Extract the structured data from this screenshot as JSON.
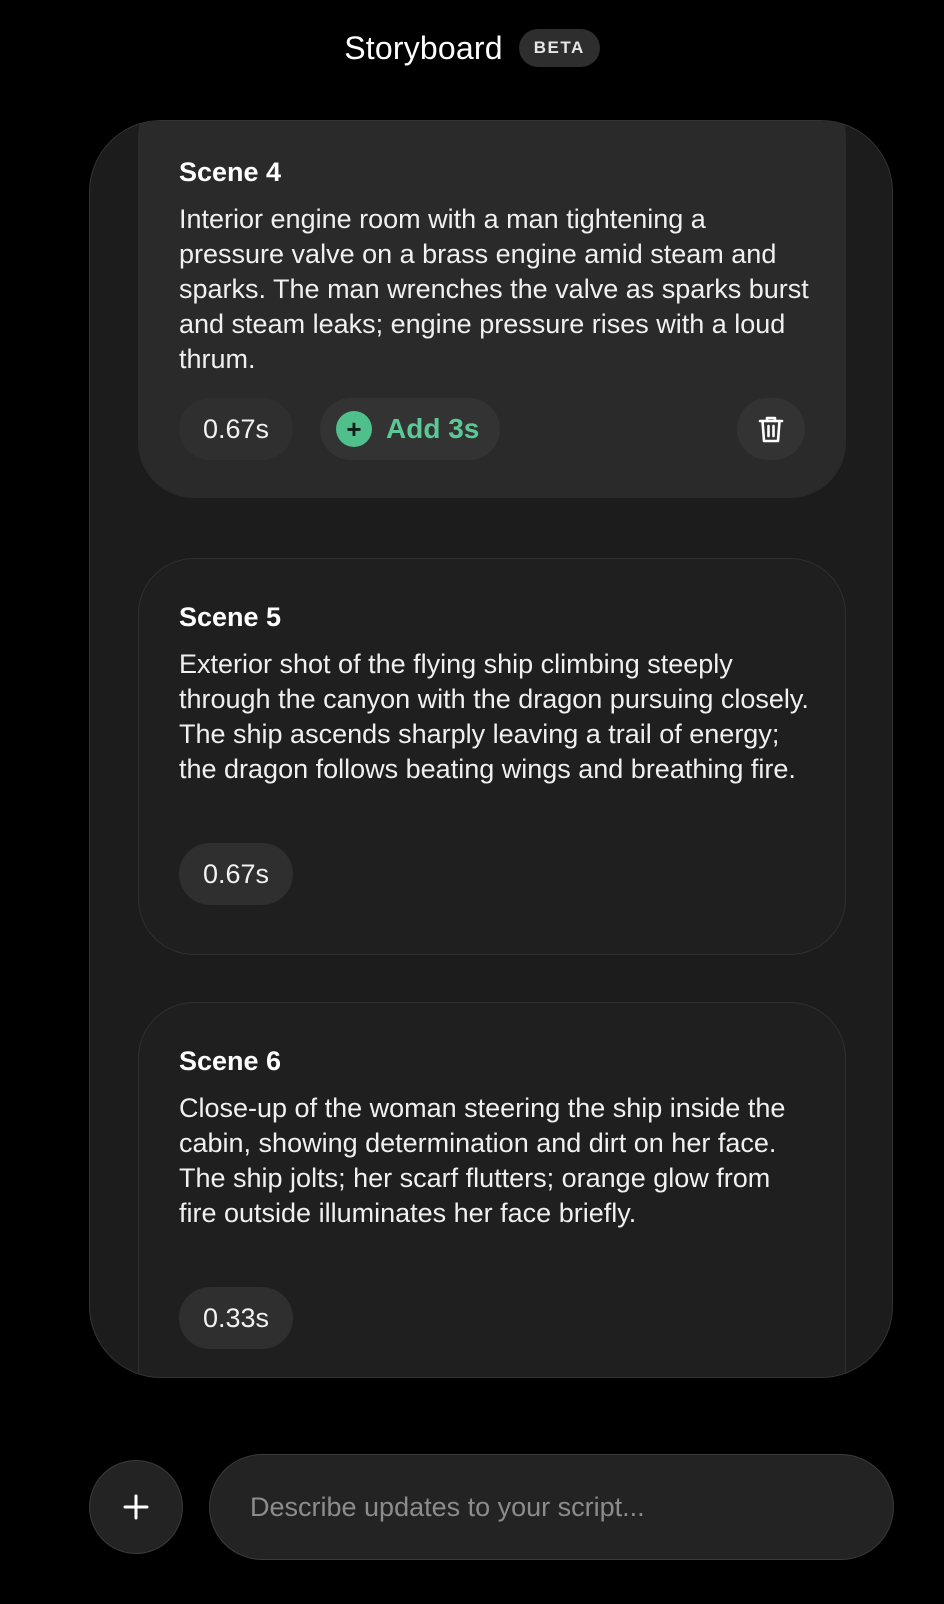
{
  "header": {
    "title": "Storyboard",
    "badge": "BETA"
  },
  "scenes": [
    {
      "heading": "Scene 4",
      "description": "Interior engine room with a man tightening a pressure valve on a brass engine amid steam and sparks. The man wrenches the valve as sparks burst and steam leaks; engine pressure rises with a loud thrum.",
      "duration": "0.67s",
      "add_label": "Add 3s",
      "selected": true
    },
    {
      "heading": "Scene 5",
      "description": "Exterior shot of the flying ship climbing steeply through the canyon with the dragon pursuing closely. The ship ascends sharply leaving a trail of energy; the dragon follows beating wings and breathing fire.",
      "duration": "0.67s",
      "selected": false
    },
    {
      "heading": "Scene 6",
      "description": "Close-up of the woman steering the ship inside the cabin, showing determination and dirt on her face. The ship jolts; her scarf flutters; orange glow from fire outside illuminates her face briefly.",
      "duration": "0.33s",
      "selected": false
    }
  ],
  "composer": {
    "placeholder": "Describe updates to your script...",
    "value": ""
  },
  "icons": {
    "add_scene": "plus-circle-icon",
    "delete": "trash-icon",
    "attach": "plus-icon"
  },
  "colors": {
    "accent": "#5bc995",
    "background": "#000000",
    "panel": "#1c1c1c",
    "selected_card": "#2a2a2a"
  }
}
